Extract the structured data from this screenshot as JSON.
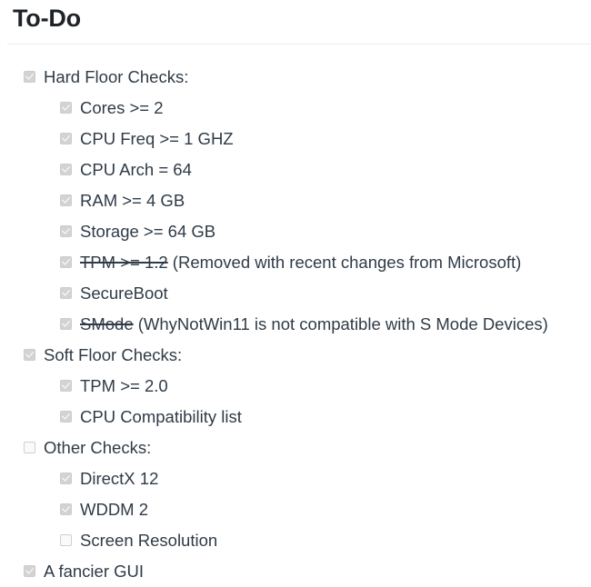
{
  "page": {
    "title": "To-Do"
  },
  "colors": {
    "text": "#2f3b47",
    "heading": "#1f2328",
    "rule": "#eaecef",
    "checkbox_checked_fill": "#d3d3d3",
    "checkbox_unchecked_fill": "#fafafa",
    "checkbox_border": "#cfcfcf",
    "background": "#ffffff"
  },
  "todo": {
    "items": [
      {
        "level": 0,
        "checked": true,
        "label": "Hard Floor Checks:",
        "strike": "",
        "note": ""
      },
      {
        "level": 1,
        "checked": true,
        "label": "Cores >= 2",
        "strike": "",
        "note": ""
      },
      {
        "level": 1,
        "checked": true,
        "label": "CPU Freq >= 1 GHZ",
        "strike": "",
        "note": ""
      },
      {
        "level": 1,
        "checked": true,
        "label": "CPU Arch = 64",
        "strike": "",
        "note": ""
      },
      {
        "level": 1,
        "checked": true,
        "label": "RAM >= 4 GB",
        "strike": "",
        "note": ""
      },
      {
        "level": 1,
        "checked": true,
        "label": "Storage >= 64 GB",
        "strike": "",
        "note": ""
      },
      {
        "level": 1,
        "checked": true,
        "label": "",
        "strike": "TPM >= 1.2",
        "note": " (Removed with recent changes from Microsoft)"
      },
      {
        "level": 1,
        "checked": true,
        "label": "SecureBoot",
        "strike": "",
        "note": ""
      },
      {
        "level": 1,
        "checked": true,
        "label": "",
        "strike": "SMode",
        "note": " (WhyNotWin11 is not compatible with S Mode Devices)"
      },
      {
        "level": 0,
        "checked": true,
        "label": "Soft Floor Checks:",
        "strike": "",
        "note": ""
      },
      {
        "level": 1,
        "checked": true,
        "label": "TPM >= 2.0",
        "strike": "",
        "note": ""
      },
      {
        "level": 1,
        "checked": true,
        "label": "CPU Compatibility list",
        "strike": "",
        "note": ""
      },
      {
        "level": 0,
        "checked": false,
        "label": "Other Checks:",
        "strike": "",
        "note": ""
      },
      {
        "level": 1,
        "checked": true,
        "label": "DirectX 12",
        "strike": "",
        "note": ""
      },
      {
        "level": 1,
        "checked": true,
        "label": "WDDM 2",
        "strike": "",
        "note": ""
      },
      {
        "level": 1,
        "checked": false,
        "label": "Screen Resolution",
        "strike": "",
        "note": ""
      },
      {
        "level": 0,
        "checked": true,
        "label": "A fancier GUI",
        "strike": "",
        "note": ""
      }
    ]
  }
}
